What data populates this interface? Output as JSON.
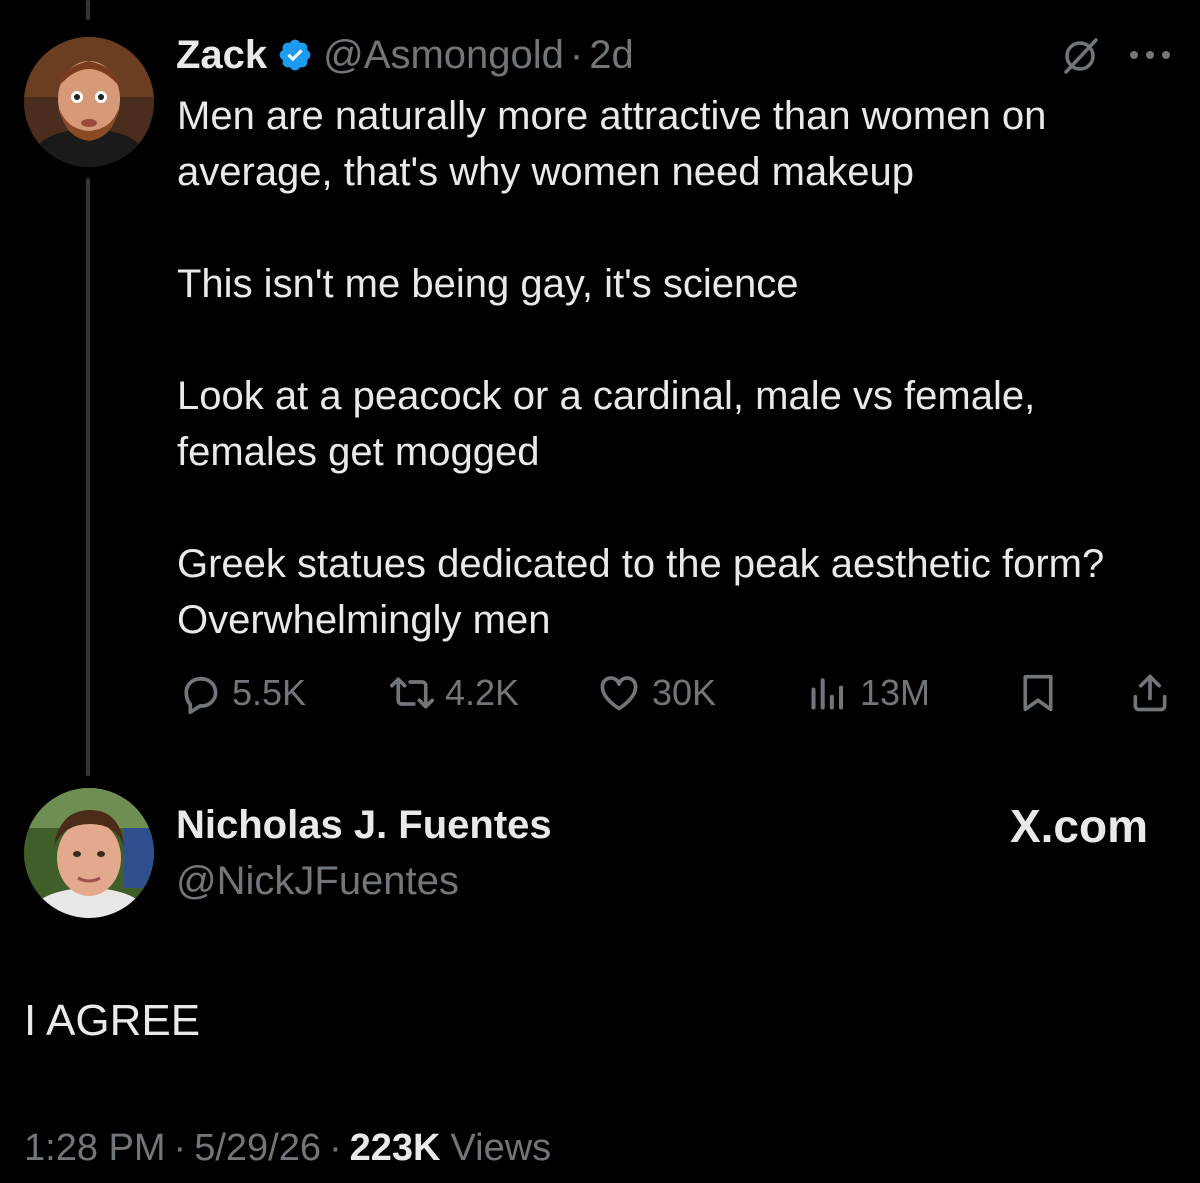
{
  "quoted_tweet": {
    "display_name": "Zack",
    "handle": "@Asmongold",
    "separator": "·",
    "time_ago": "2d",
    "paragraphs": [
      "Men are naturally more attractive than women on average, that's why women need makeup",
      "This isn't me being gay, it's science",
      "Look at a peacock or a cardinal, male vs female, females get mogged",
      "Greek statues dedicated to the peak aesthetic form? Overwhelmingly men"
    ],
    "actions": {
      "replies": "5.5K",
      "reposts": "4.2K",
      "likes": "30K",
      "views": "13M"
    },
    "icons": [
      "verified-badge-icon",
      "grok-icon",
      "more-icon",
      "reply-icon",
      "repost-icon",
      "like-icon",
      "views-icon",
      "bookmark-icon",
      "share-icon"
    ]
  },
  "main_tweet": {
    "display_name": "Nicholas J. Fuentes",
    "handle": "@NickJFuentes",
    "text": "I AGREE",
    "time": "1:28 PM",
    "separator": "·",
    "date": "5/29/26",
    "views_count": "223K",
    "views_label": "Views"
  },
  "watermark": "X.com",
  "colors": {
    "background": "#000000",
    "text": "#e7e9ea",
    "muted": "#71767b",
    "verified": "#1d9bf0"
  }
}
